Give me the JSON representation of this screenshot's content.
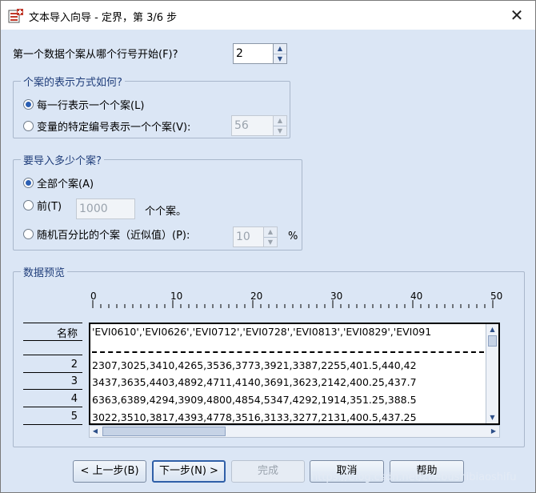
{
  "window": {
    "title": "文本导入向导 - 定界，第 3/6 步",
    "close_glyph": "✕"
  },
  "first_case": {
    "label": "第一个数据个案从哪个行号开始(F)?",
    "value": "2"
  },
  "case_representation": {
    "title": "个案的表示方式如何?",
    "option_each_line": "每一行表示一个个案(L)",
    "option_variable": "变量的特定编号表示一个个案(V):",
    "variable_count": "56",
    "selected": "each_line"
  },
  "cases_to_import": {
    "title": "要导入多少个案?",
    "option_all": "全部个案(A)",
    "option_first": "前(T)",
    "first_count": "1000",
    "first_suffix": "个个案。",
    "option_random": "随机百分比的个案（近似值）(P):",
    "random_percent": "10",
    "percent_sign": "%",
    "selected": "all"
  },
  "preview": {
    "title": "数据预览",
    "ruler_labels": [
      "0",
      "10",
      "20",
      "30",
      "40",
      "50"
    ],
    "header_label": "名称",
    "header_line": "'EVI0610','EVI0626','EVI0712','EVI0728','EVI0813','EVI0829','EVI091",
    "rows": [
      {
        "num": "2",
        "text": "2307,3025,3410,4265,3536,3773,3921,3387,2255,401.5,440,42"
      },
      {
        "num": "3",
        "text": "3437,3635,4403,4892,4711,4140,3691,3623,2142,400.25,437.7"
      },
      {
        "num": "4",
        "text": "6363,6389,4294,3909,4800,4854,5347,4292,1914,351.25,388.5"
      },
      {
        "num": "5",
        "text": "3022,3510,3817,4393,4778,3516,3133,3277,2131,400.5,437.25"
      }
    ]
  },
  "buttons": {
    "back": "< 上一步(B)",
    "next": "下一步(N) >",
    "finish": "完成",
    "cancel": "取消",
    "help": "帮助"
  },
  "watermark": "https://blog.csdn.net/zhebushibiaoshifu",
  "colors": {
    "background": "#dbe6f5",
    "group_title": "#1f3d7a",
    "accent": "#2b5fb3"
  }
}
